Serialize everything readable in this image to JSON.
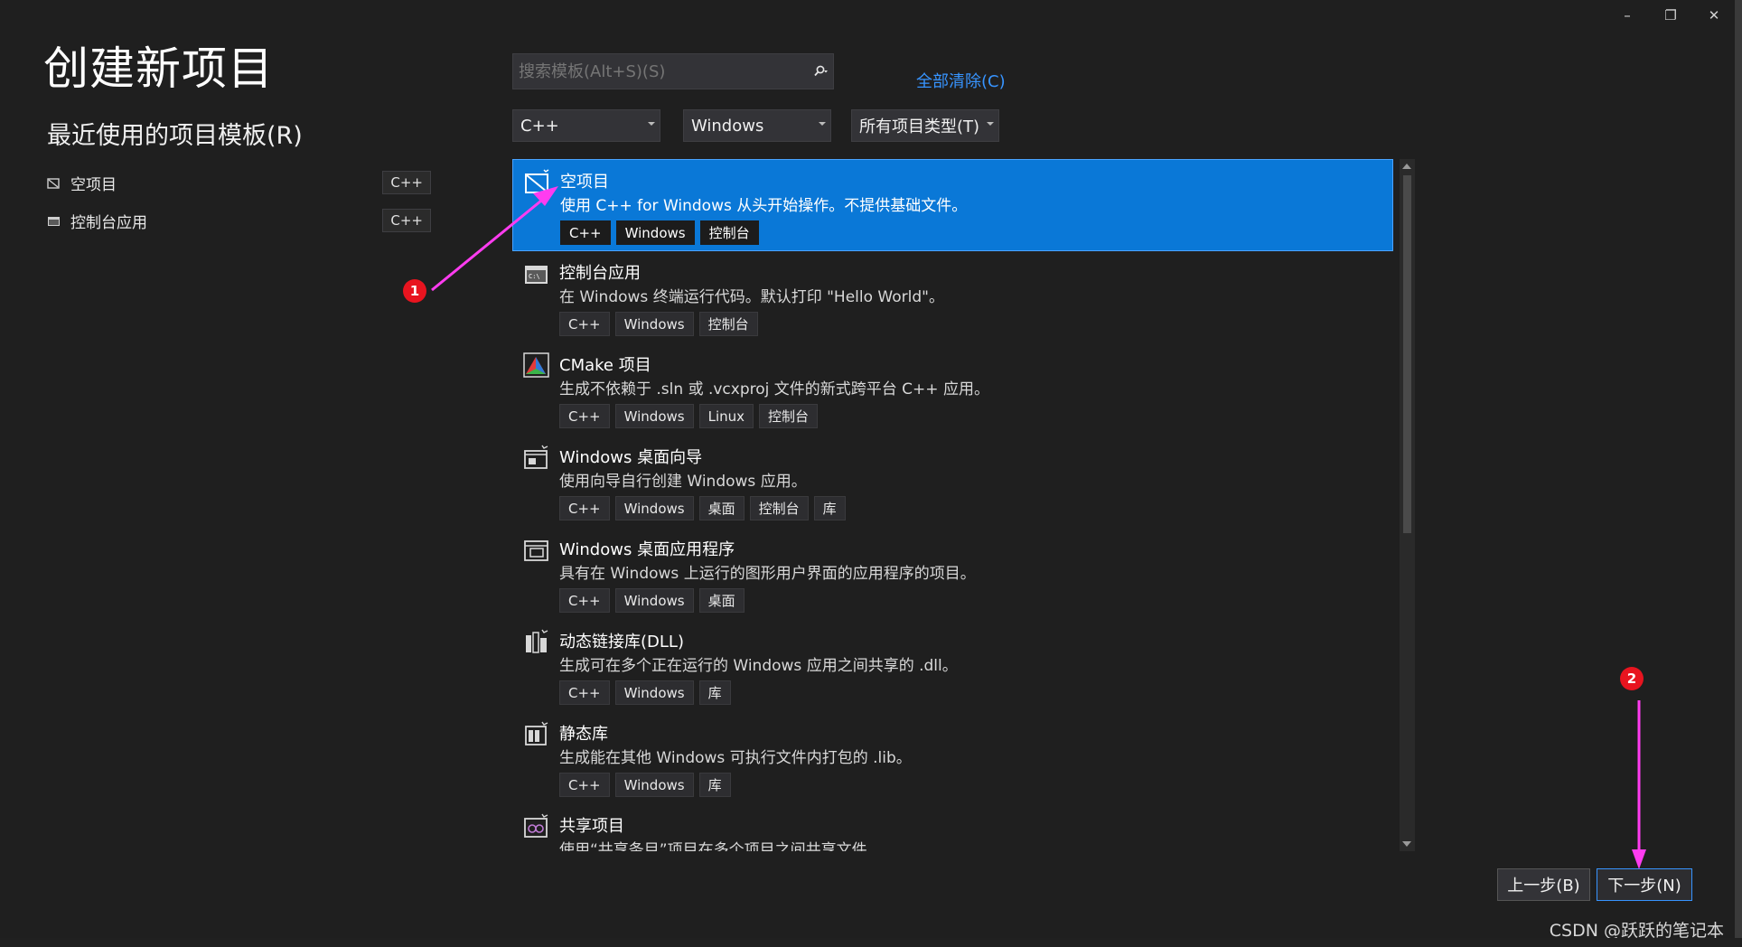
{
  "window": {
    "minimize_icon": "minimize-icon",
    "restore_icon": "restore-icon",
    "close_icon": "close-icon"
  },
  "page_title": "创建新项目",
  "recent": {
    "heading": "最近使用的项目模板(R)",
    "items": [
      {
        "label": "空项目",
        "tag": "C++"
      },
      {
        "label": "控制台应用",
        "tag": "C++"
      }
    ]
  },
  "search": {
    "placeholder": "搜索模板(Alt+S)(S)",
    "value": ""
  },
  "clear_all": "全部清除(C)",
  "filters": {
    "language": "C++",
    "platform": "Windows",
    "project_type": "所有项目类型(T)"
  },
  "templates": [
    {
      "name": "空项目",
      "desc": "使用 C++ for Windows 从头开始操作。不提供基础文件。",
      "tags": [
        "C++",
        "Windows",
        "控制台"
      ],
      "selected": true
    },
    {
      "name": "控制台应用",
      "desc": "在 Windows 终端运行代码。默认打印 \"Hello World\"。",
      "tags": [
        "C++",
        "Windows",
        "控制台"
      ]
    },
    {
      "name": "CMake 项目",
      "desc": "生成不依赖于 .sln 或 .vcxproj 文件的新式跨平台 C++ 应用。",
      "tags": [
        "C++",
        "Windows",
        "Linux",
        "控制台"
      ]
    },
    {
      "name": "Windows 桌面向导",
      "desc": "使用向导自行创建 Windows 应用。",
      "tags": [
        "C++",
        "Windows",
        "桌面",
        "控制台",
        "库"
      ]
    },
    {
      "name": "Windows 桌面应用程序",
      "desc": "具有在 Windows 上运行的图形用户界面的应用程序的项目。",
      "tags": [
        "C++",
        "Windows",
        "桌面"
      ]
    },
    {
      "name": "动态链接库(DLL)",
      "desc": "生成可在多个正在运行的 Windows 应用之间共享的 .dll。",
      "tags": [
        "C++",
        "Windows",
        "库"
      ]
    },
    {
      "name": "静态库",
      "desc": "生成能在其他 Windows 可执行文件内打包的 .lib。",
      "tags": [
        "C++",
        "Windows",
        "库"
      ]
    },
    {
      "name": "共享项目",
      "desc": "使用“共享条目”项目在多个项目之间共享文件。",
      "tags": []
    }
  ],
  "buttons": {
    "back": "上一步(B)",
    "next": "下一步(N)"
  },
  "annotations": {
    "badge1": "1",
    "badge2": "2",
    "arrow_color": "#ff3cf0"
  },
  "watermark": "CSDN @跃跃的笔记本",
  "colors": {
    "accent": "#0a78d7",
    "link": "#3794ff",
    "background": "#1f1f1f"
  }
}
